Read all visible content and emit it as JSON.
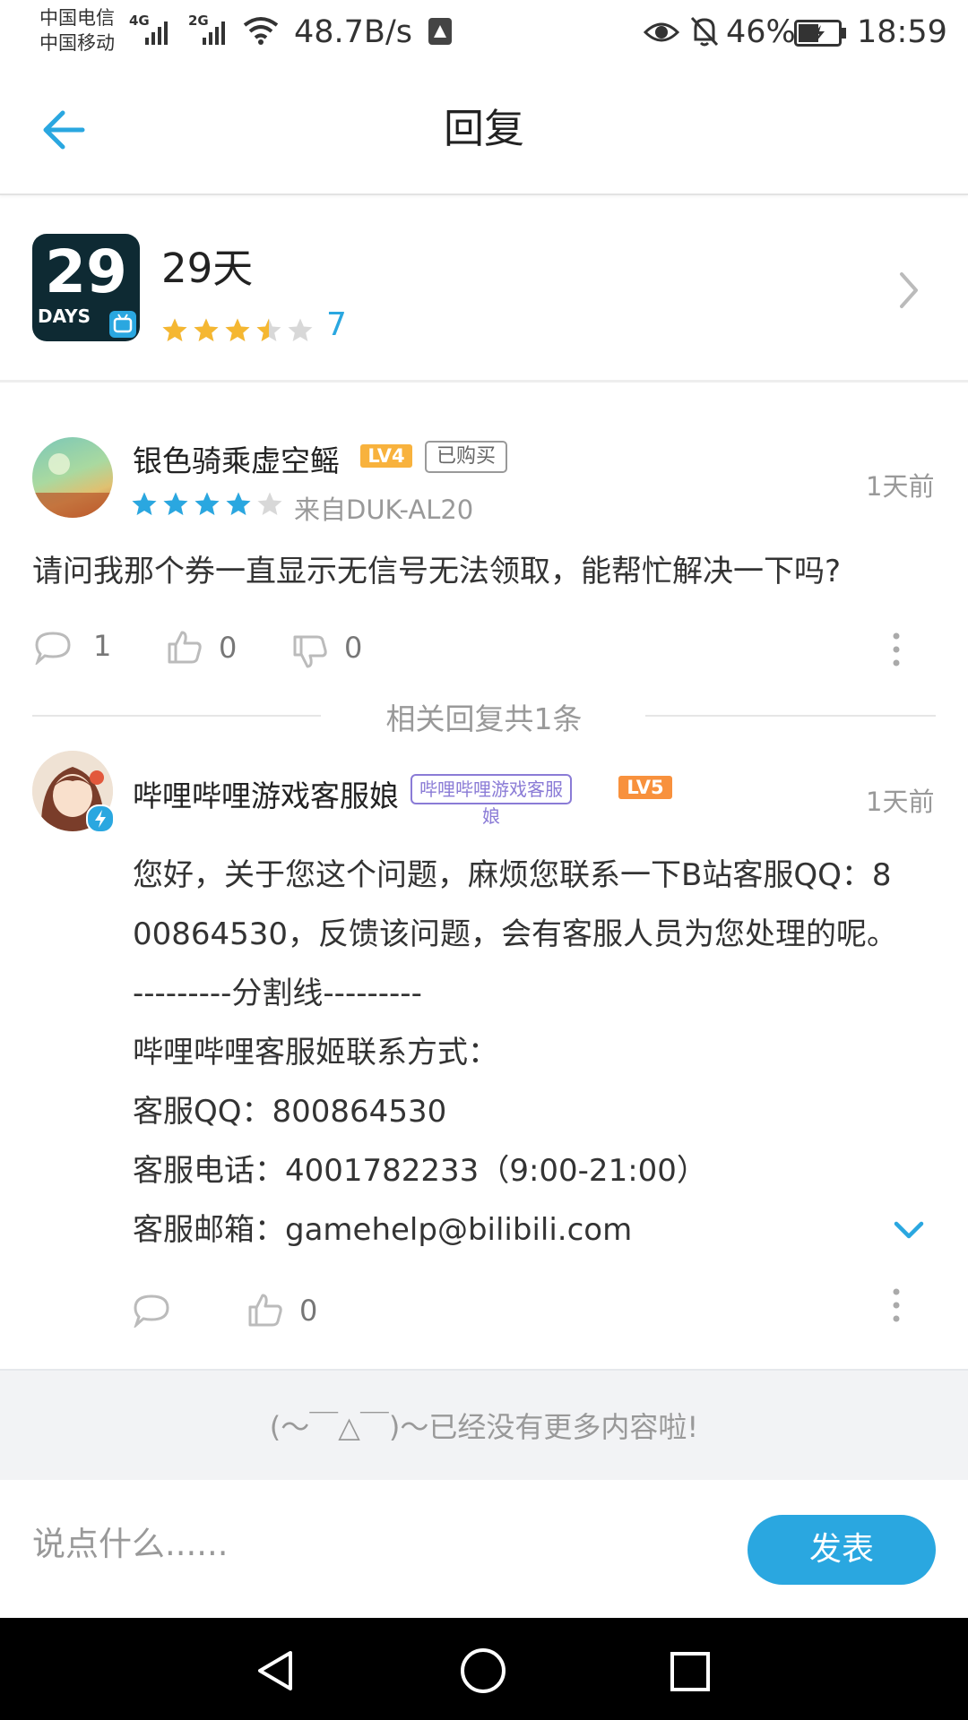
{
  "status_bar": {
    "carrier_1": "中国电信",
    "carrier_2": "中国移动",
    "net_4g": "4G",
    "net_2g": "2G",
    "speed": "48.7B/s",
    "battery": "46%",
    "time": "18:59"
  },
  "header": {
    "title": "回复"
  },
  "game": {
    "icon_text_big": "29",
    "icon_text_small": "DAYS",
    "name": "29天",
    "rating_stars": 3.5,
    "rating_count": "7"
  },
  "comment": {
    "username": "银色骑乘虚空鳐",
    "level": "LV4",
    "purchased_badge": "已购买",
    "rating_stars": 4,
    "source": "来自DUK-AL20",
    "time": "1天前",
    "text": "请问我那个券一直显示无信号无法领取，能帮忙解决一下吗?",
    "reply_count": "1",
    "like_count": "0",
    "dislike_count": "0"
  },
  "replies_divider": "相关回复共1条",
  "reply": {
    "username": "哔哩哔哩游戏客服娘",
    "role_badge": "哔哩哔哩游戏客服娘",
    "level": "LV5",
    "time": "1天前",
    "lines": [
      "您好，关于您这个问题，麻烦您联系一下B站客服QQ：8",
      "00864530，反馈该问题，会有客服人员为您处理的呢。",
      "---------分割线---------",
      "哔哩哔哩客服姬联系方式：",
      "客服QQ：800864530",
      "客服电话：4001782233（9:00-21:00）",
      "客服邮箱：gamehelp@bilibili.com"
    ],
    "like_count": "0"
  },
  "end_text": "(～￣△￣)～已经没有更多内容啦!",
  "composer": {
    "placeholder": "说点什么......",
    "send_label": "发表"
  },
  "colors": {
    "accent": "#2aa7e0",
    "star_orange": "#f5b731",
    "star_blue": "#2aa7e0",
    "level_orange": "#f8913d",
    "role_purple": "#8a7bd6"
  }
}
